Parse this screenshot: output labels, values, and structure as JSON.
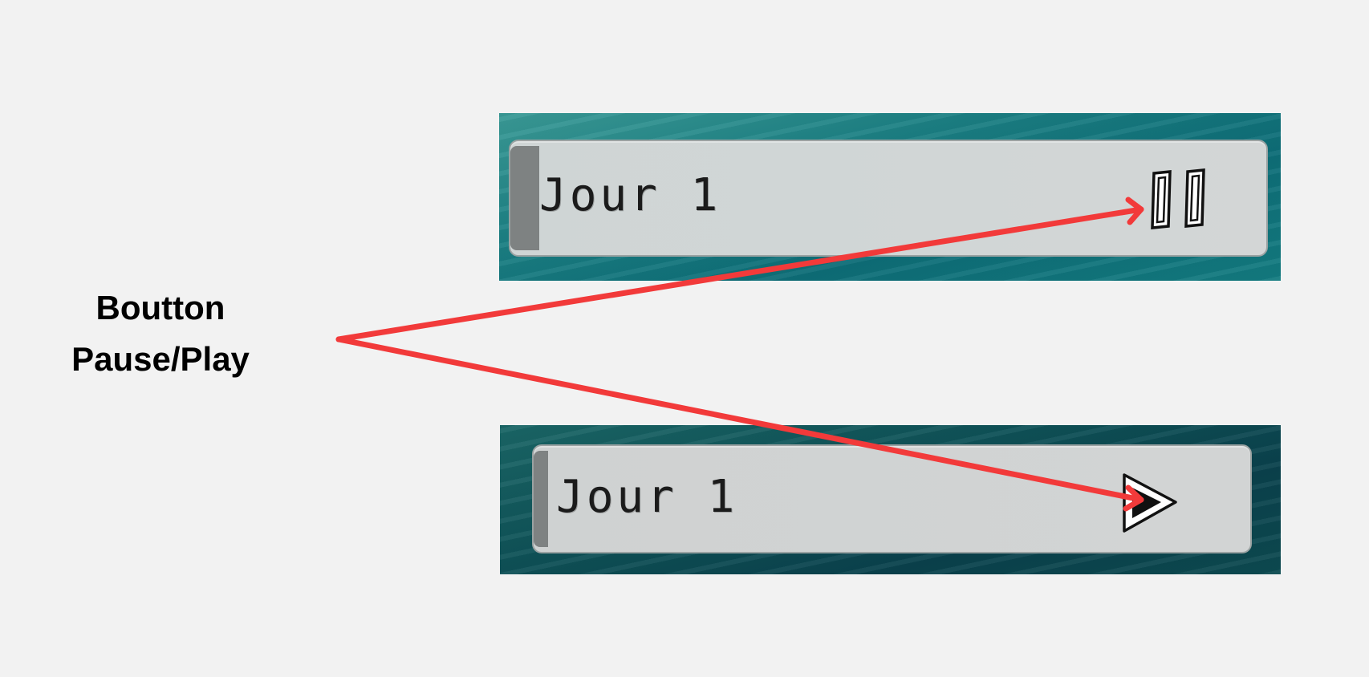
{
  "annotation": {
    "line1": "Boutton",
    "line2": "Pause/Play"
  },
  "playing_state": {
    "day_label": "Jour 1",
    "button_icon": "pause-icon"
  },
  "paused_state": {
    "day_label": "Jour 1",
    "button_icon": "play-icon"
  },
  "colors": {
    "arrow": "#f23a3a",
    "panel_playing": "#1b7f83",
    "panel_paused": "#0e5157",
    "bar": "#d1d6d6",
    "bar_tab": "#7e8282",
    "label_text": "#1b1b1b",
    "background": "#f2f2f2"
  }
}
